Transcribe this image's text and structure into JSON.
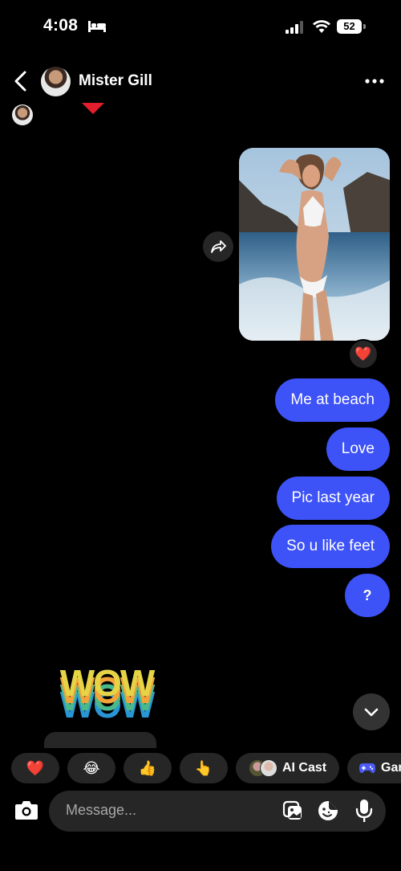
{
  "status_bar": {
    "time": "4:08",
    "battery": "52"
  },
  "header": {
    "contact_name": "Mister Gill"
  },
  "messages": [
    {
      "text": "Me at beach"
    },
    {
      "text": "Love"
    },
    {
      "text": "Pic last year"
    },
    {
      "text": "So u like feet"
    },
    {
      "text": "?"
    }
  ],
  "photo_reaction": "❤️",
  "sticker_text": "WOW",
  "quick_reactions": [
    {
      "emoji": "❤️"
    },
    {
      "emoji": "😂"
    },
    {
      "emoji": "👍"
    },
    {
      "emoji": "👆"
    }
  ],
  "chips": {
    "ai_cast": "AI Cast",
    "games": "Gar"
  },
  "composer": {
    "placeholder": "Message..."
  },
  "colors": {
    "bubble": "#3d52f7",
    "background": "#000000",
    "surface": "#262626"
  }
}
